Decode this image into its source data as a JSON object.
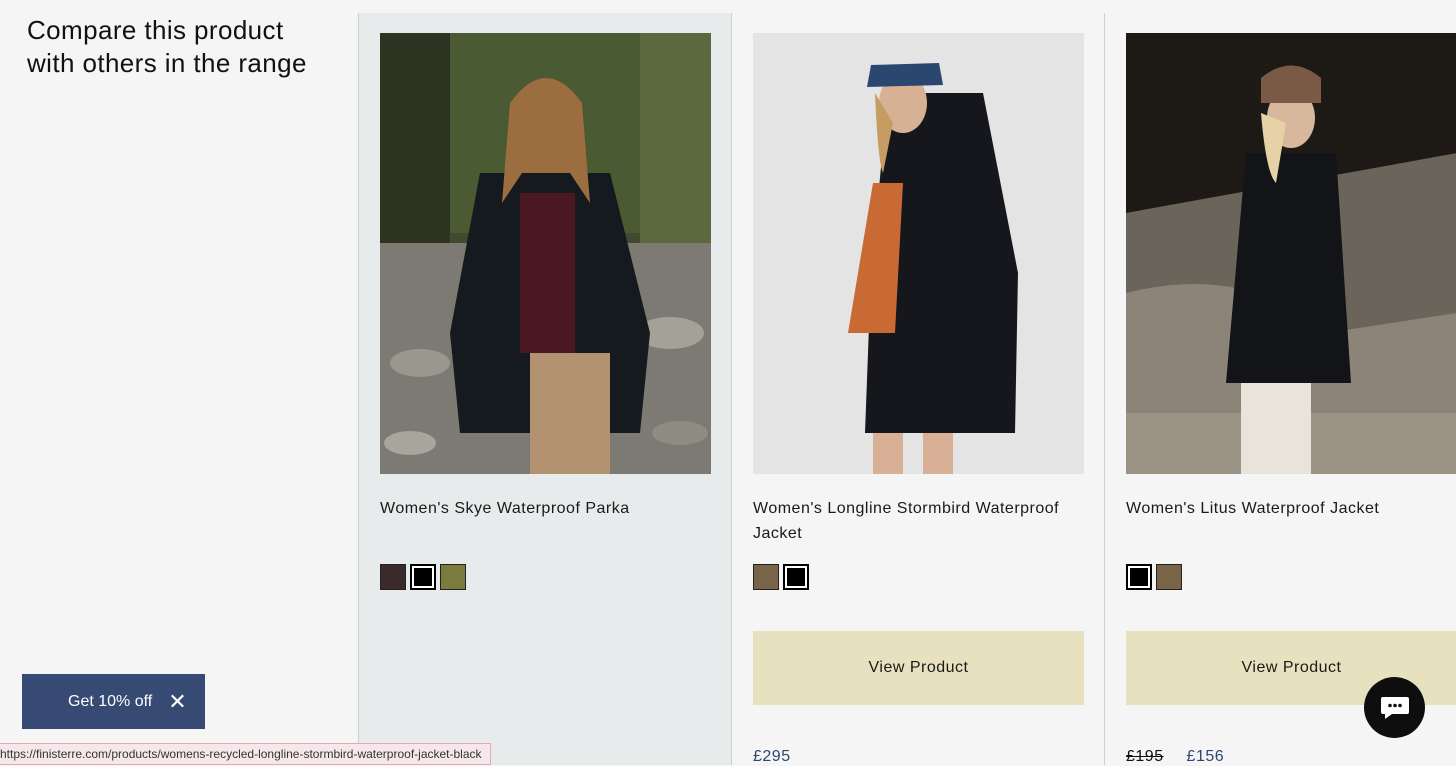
{
  "heading": "Compare this product with others in the range",
  "products": [
    {
      "name": "Women's Skye Waterproof Parka",
      "swatches": [
        "#3b2a2a",
        "#000000",
        "#7b7b3e"
      ],
      "photo": "woman-in-dark-parka-rocky-forest"
    },
    {
      "name": "Women's Longline Stormbird Waterproof Jacket",
      "swatches": [
        "#7a6448",
        "#000000"
      ],
      "button": "View Product",
      "price": "£295",
      "photo": "woman-in-black-longline-jacket-studio"
    },
    {
      "name": "Women's Litus Waterproof Jacket",
      "swatches": [
        "#000000",
        "#7a6448"
      ],
      "button": "View Product",
      "price_old": "£195",
      "price": "£156",
      "photo": "woman-in-black-jacket-beach-rocks"
    }
  ],
  "promo": {
    "label": "Get 10% off",
    "close_icon": "close-icon"
  },
  "status_url": "https://finisterre.com/products/womens-recycled-longline-stormbird-waterproof-jacket-black",
  "chat_icon": "chat-bubble-icon"
}
